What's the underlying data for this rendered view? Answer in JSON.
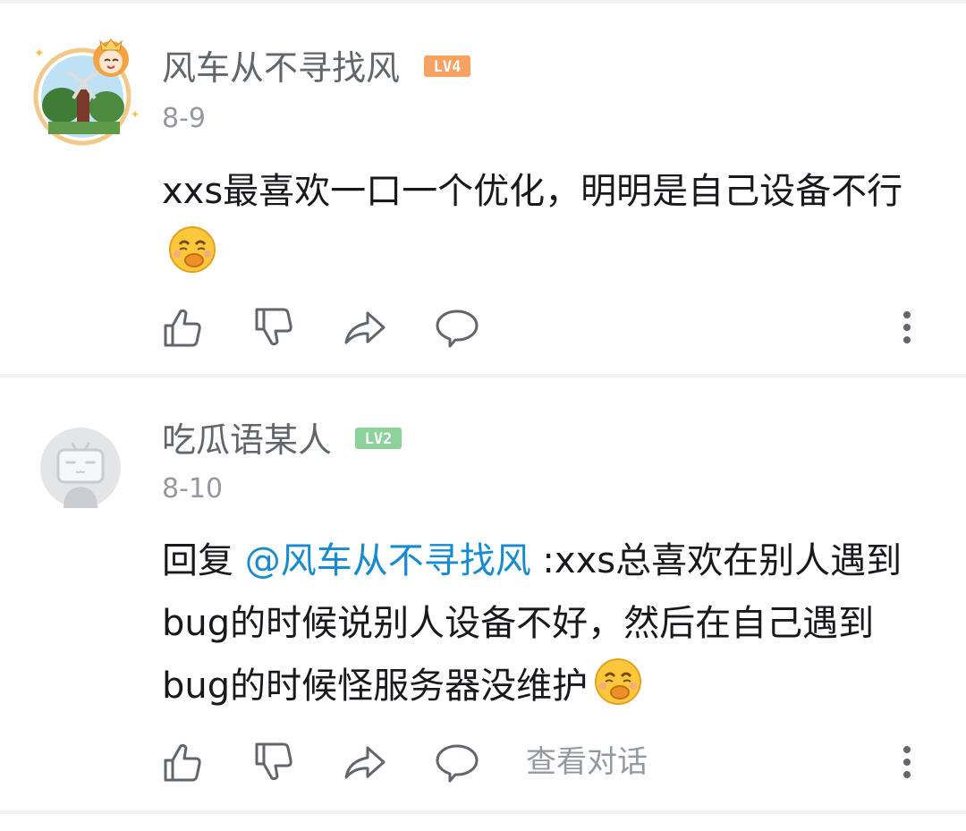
{
  "comments": [
    {
      "username": "风车从不寻找风",
      "level": "LV4",
      "level_color": "#f6a263",
      "date": "8-9",
      "text": "xxs最喜欢一口一个优化，明明是自己设备不行",
      "emoji": "laughing-face-emoji"
    },
    {
      "username": "吃瓜语某人",
      "level": "LV2",
      "level_color": "#8bd29b",
      "date": "8-10",
      "reply_prefix": "回复 ",
      "mention": "@风车从不寻找风",
      "text": " :xxs总喜欢在别人遇到bug的时候说别人设备不好，然后在自己遇到bug的时候怪服务器没维护",
      "emoji": "laughing-face-emoji",
      "view_conversation": "查看对话"
    }
  ],
  "colors": {
    "mention": "#178bcf",
    "username": "#61666d",
    "meta": "#9499a0",
    "icon": "#61666d"
  },
  "icons": [
    "thumbs-up-icon",
    "thumbs-down-icon",
    "share-icon",
    "reply-icon",
    "more-icon"
  ]
}
